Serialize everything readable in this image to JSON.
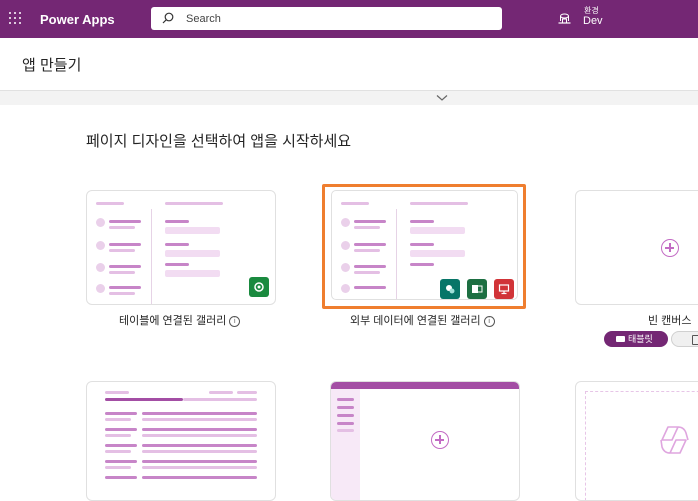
{
  "header": {
    "app_name": "Power Apps",
    "search_placeholder": "Search",
    "environment_label": "환경",
    "environment_value": "Dev",
    "brand_color": "#742774"
  },
  "page": {
    "title": "앱 만들기",
    "section_heading": "페이지 디자인을 선택하여 앱을 시작하세요"
  },
  "cards": [
    {
      "label": "테이블에 연결된 갤러리",
      "info_icon": "info-icon",
      "badges": [
        "dataverse-icon"
      ]
    },
    {
      "label": "외부 데이터에 연결된 갤러리",
      "info_icon": "info-icon",
      "badges": [
        "sharepoint-icon",
        "excel-icon",
        "sql-icon"
      ],
      "selected": true
    },
    {
      "label": "빈 캔버스",
      "badges": []
    }
  ],
  "chips": {
    "tablet": "태블릿",
    "phone": ""
  },
  "accent_orange": "#ef7e2f"
}
